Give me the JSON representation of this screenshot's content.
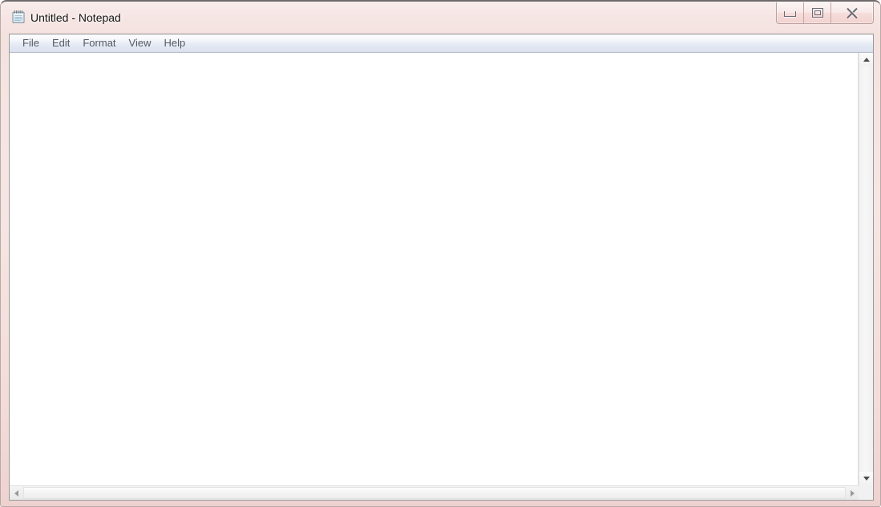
{
  "window": {
    "title": "Untitled - Notepad",
    "icon": "notepad-icon",
    "frame_color": "#f4e2df",
    "titlebar_text_color": "#161616"
  },
  "window_controls": [
    {
      "name": "minimize",
      "label": "Minimize",
      "glyph": "minimize-icon"
    },
    {
      "name": "restore",
      "label": "Restore",
      "glyph": "restore-icon"
    },
    {
      "name": "close",
      "label": "Close",
      "glyph": "close-icon"
    }
  ],
  "menu": {
    "items": [
      {
        "label": "File"
      },
      {
        "label": "Edit"
      },
      {
        "label": "Format"
      },
      {
        "label": "View"
      },
      {
        "label": "Help"
      }
    ],
    "text_color": "#555a63"
  },
  "editor": {
    "content": "",
    "background": "#ffffff",
    "font": "monospace"
  },
  "scrollbars": {
    "vertical": {
      "up_arrow": "triangle-up-icon",
      "down_arrow": "triangle-down-icon",
      "thumb_visible": false
    },
    "horizontal": {
      "left_arrow": "triangle-left-icon",
      "right_arrow": "triangle-right-icon",
      "thumb_visible": false
    },
    "resize_grip": "resize-grip-icon"
  }
}
